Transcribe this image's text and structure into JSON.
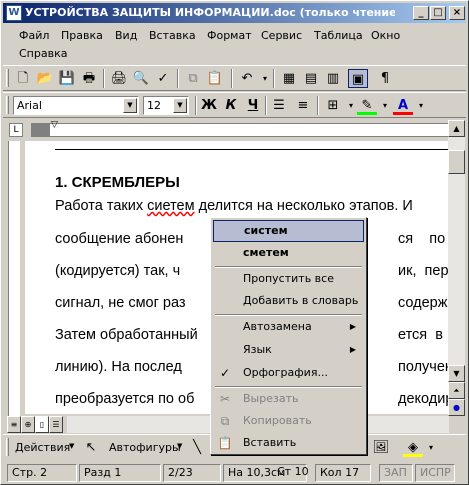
{
  "window": {
    "title": "УСТРОЙСТВА ЗАЩИТЫ ИНФОРМАЦИИ.doc (только чтение) - Micr",
    "icon_letter": "W",
    "btn_min": "_",
    "btn_max": "□",
    "btn_close": "×"
  },
  "menubar": {
    "items": [
      "Файл",
      "Правка",
      "Вид",
      "Вставка",
      "Формат",
      "Сервис",
      "Таблица",
      "Окно",
      "Справка"
    ]
  },
  "format_toolbar": {
    "font": "Arial",
    "size": "12",
    "bold": "Ж",
    "italic": "К",
    "underline": "Ч"
  },
  "document": {
    "heading": "1. СКРЕМБЛЕРЫ",
    "lines": [
      [
        "Работа таких ",
        "сиетем",
        " делится на несколько этапов. И"
      ],
      [
        "сообщение     абонен",
        "",
        "ся    по    к"
      ],
      [
        "(кодируется)  так,  ч",
        "",
        "ик,  перехв"
      ],
      [
        "сигнал,  не  смог  раз",
        "",
        "содержани"
      ],
      [
        "Затем  обработанный",
        "",
        "ется  в  ка"
      ],
      [
        "линию).   На   послед",
        "",
        "получен"
      ],
      [
        "преобразуется по об",
        "",
        "декодирует"
      ]
    ]
  },
  "context_menu": {
    "items": [
      {
        "label": "систем",
        "kind": "suggestion"
      },
      {
        "label": "сметем",
        "kind": "suggestion"
      },
      {
        "label": "Пропустить все",
        "kind": "normal"
      },
      {
        "label": "Добавить в словарь",
        "kind": "normal"
      },
      {
        "label": "Автозамена",
        "kind": "submenu"
      },
      {
        "label": "Язык",
        "kind": "submenu"
      },
      {
        "label": "Орфография...",
        "kind": "normal"
      },
      {
        "label": "Вырезать",
        "kind": "disabled"
      },
      {
        "label": "Копировать",
        "kind": "disabled"
      },
      {
        "label": "Вставить",
        "kind": "normal"
      }
    ]
  },
  "drawbar": {
    "actions": "Действия",
    "autoshapes": "Автофигуры"
  },
  "statusbar": {
    "page": "Стр. 2",
    "section": "Разд 1",
    "pages": "2/23",
    "position": "На 10,3см",
    "line": "Ст 10",
    "col": "Кол 17",
    "rec": "ЗАП",
    "trk": "ИСПР"
  },
  "colors": {
    "title_start": "#0a246a",
    "title_end": "#a6caf0",
    "selection": "#b6bdd2",
    "spell_error": "#ff0000"
  }
}
